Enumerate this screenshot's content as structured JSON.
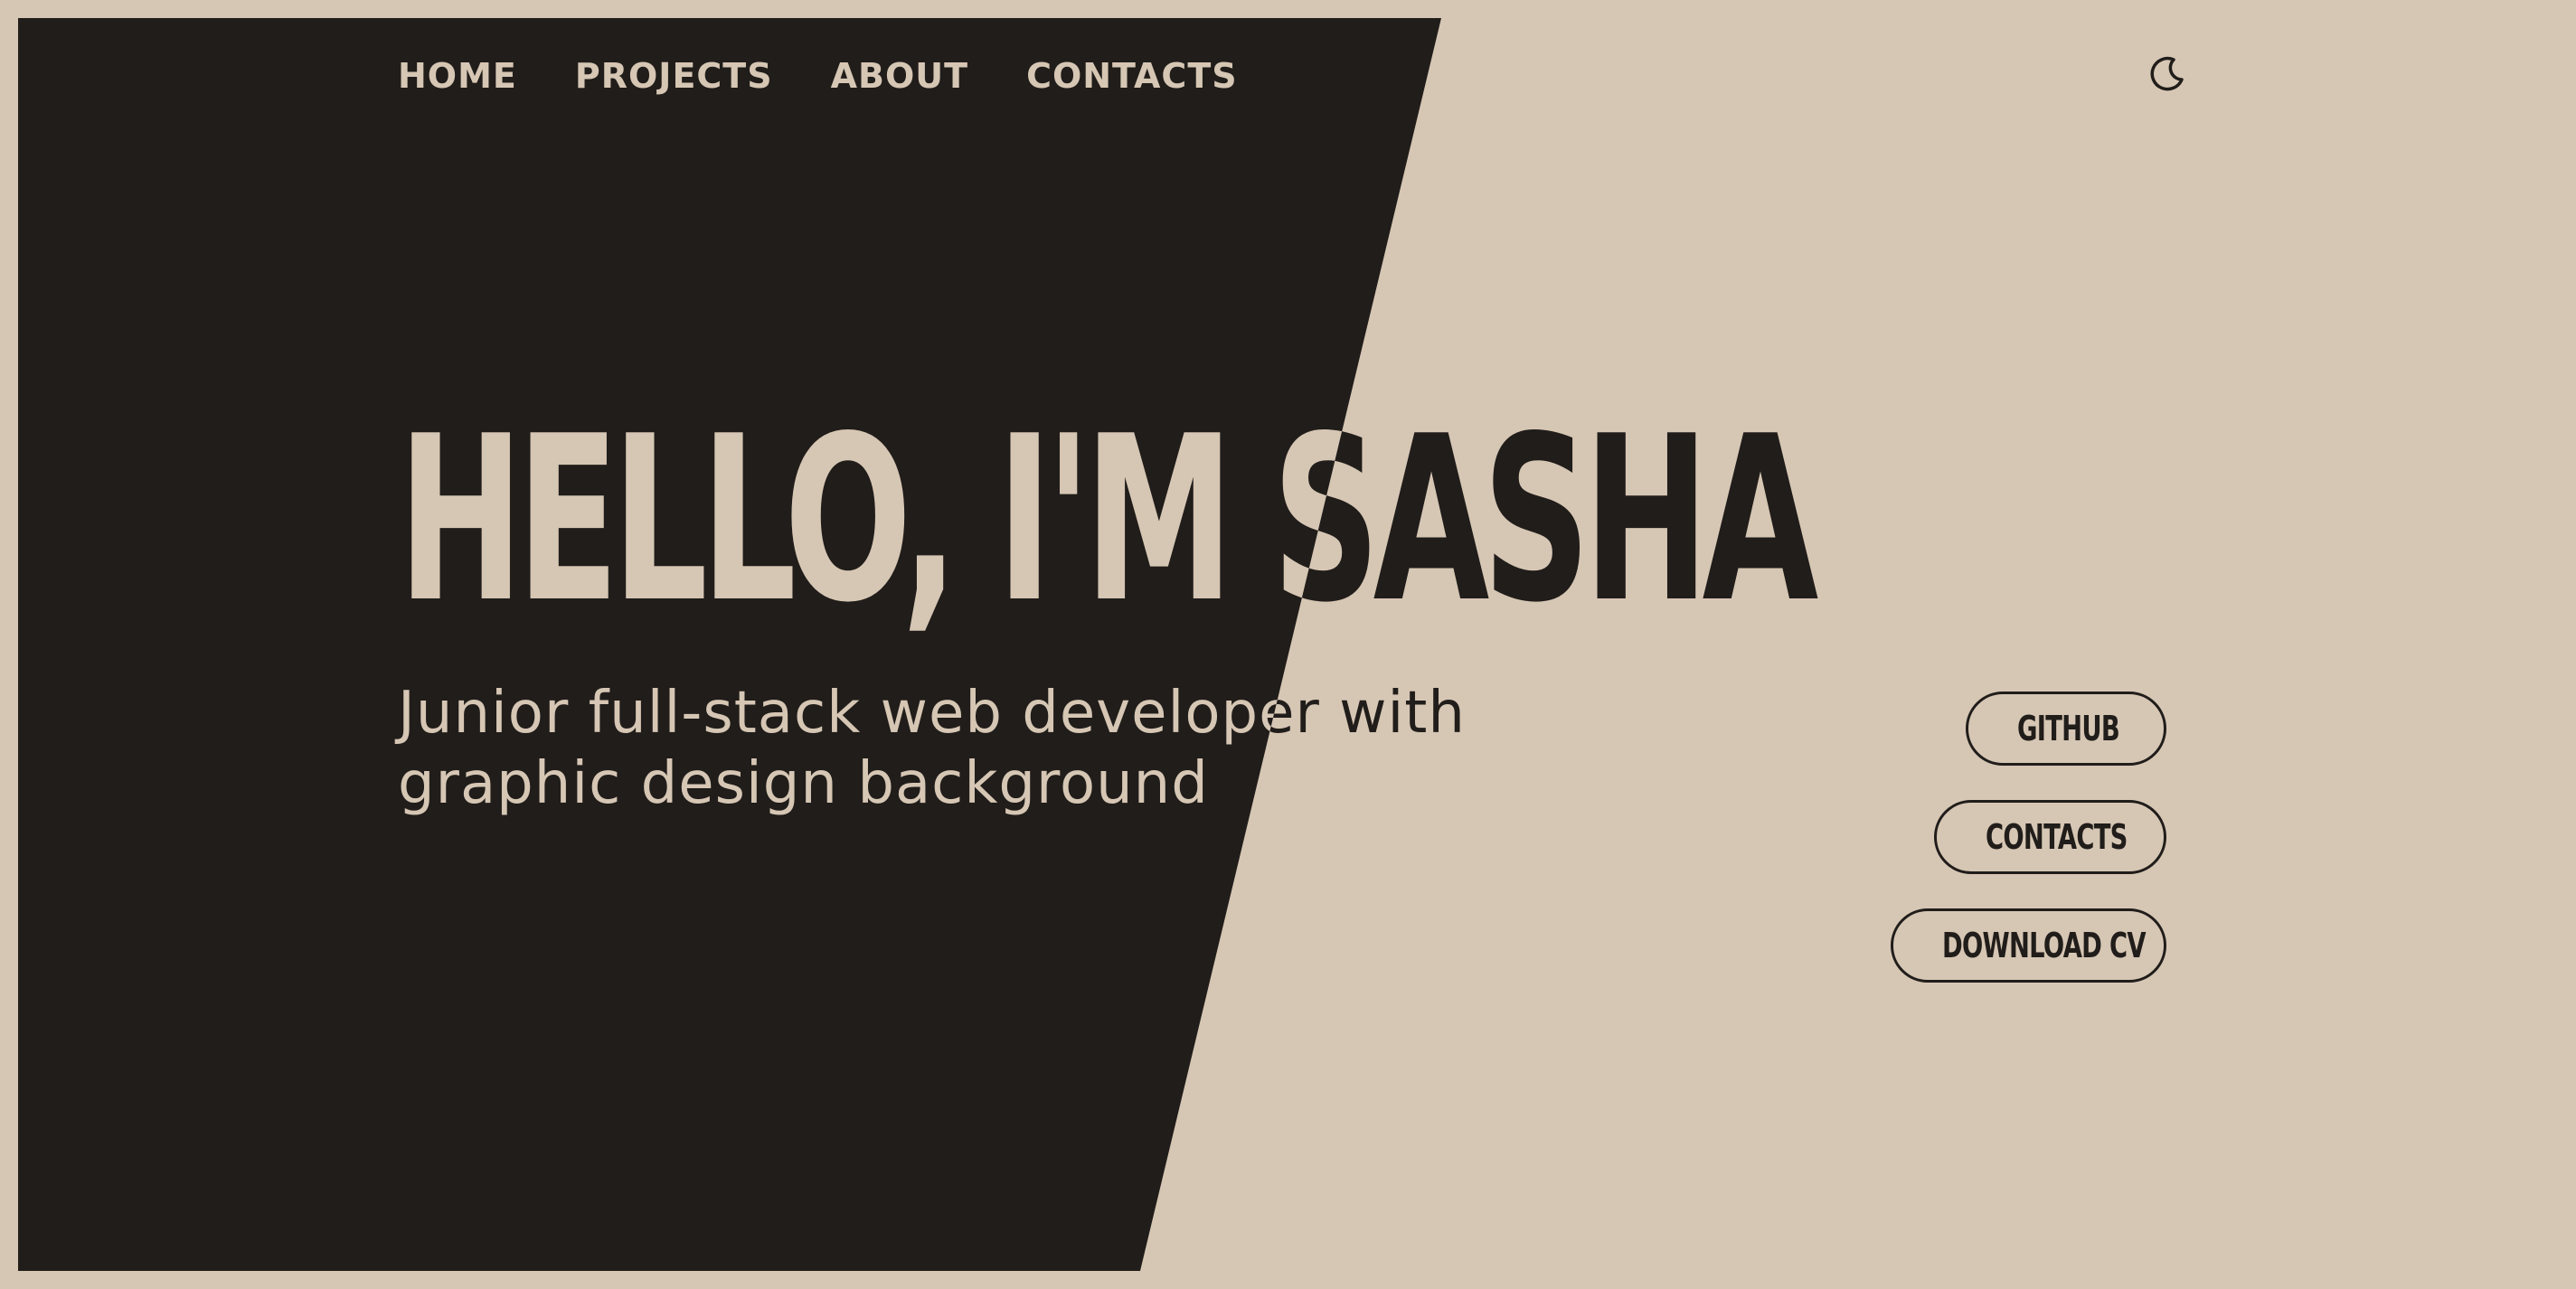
{
  "nav": {
    "items": [
      {
        "label": "HOME"
      },
      {
        "label": "PROJECTS"
      },
      {
        "label": "ABOUT"
      },
      {
        "label": "CONTACTS"
      }
    ],
    "theme_toggle_icon": "moon-icon"
  },
  "hero": {
    "title": "HELLO, I'M SASHA",
    "subtitle": "Junior full-stack web developer with graphic design background"
  },
  "actions": {
    "github": {
      "label": "GITHUB",
      "icon": "arrow-up-right-icon"
    },
    "contacts": {
      "label": "CONTACTS",
      "icon": "at-sign-icon"
    },
    "download_cv": {
      "label": "DOWNLOAD CV",
      "icon": "download-icon"
    }
  },
  "colors": {
    "background": "#d6c6b4",
    "dark": "#201d1a"
  }
}
